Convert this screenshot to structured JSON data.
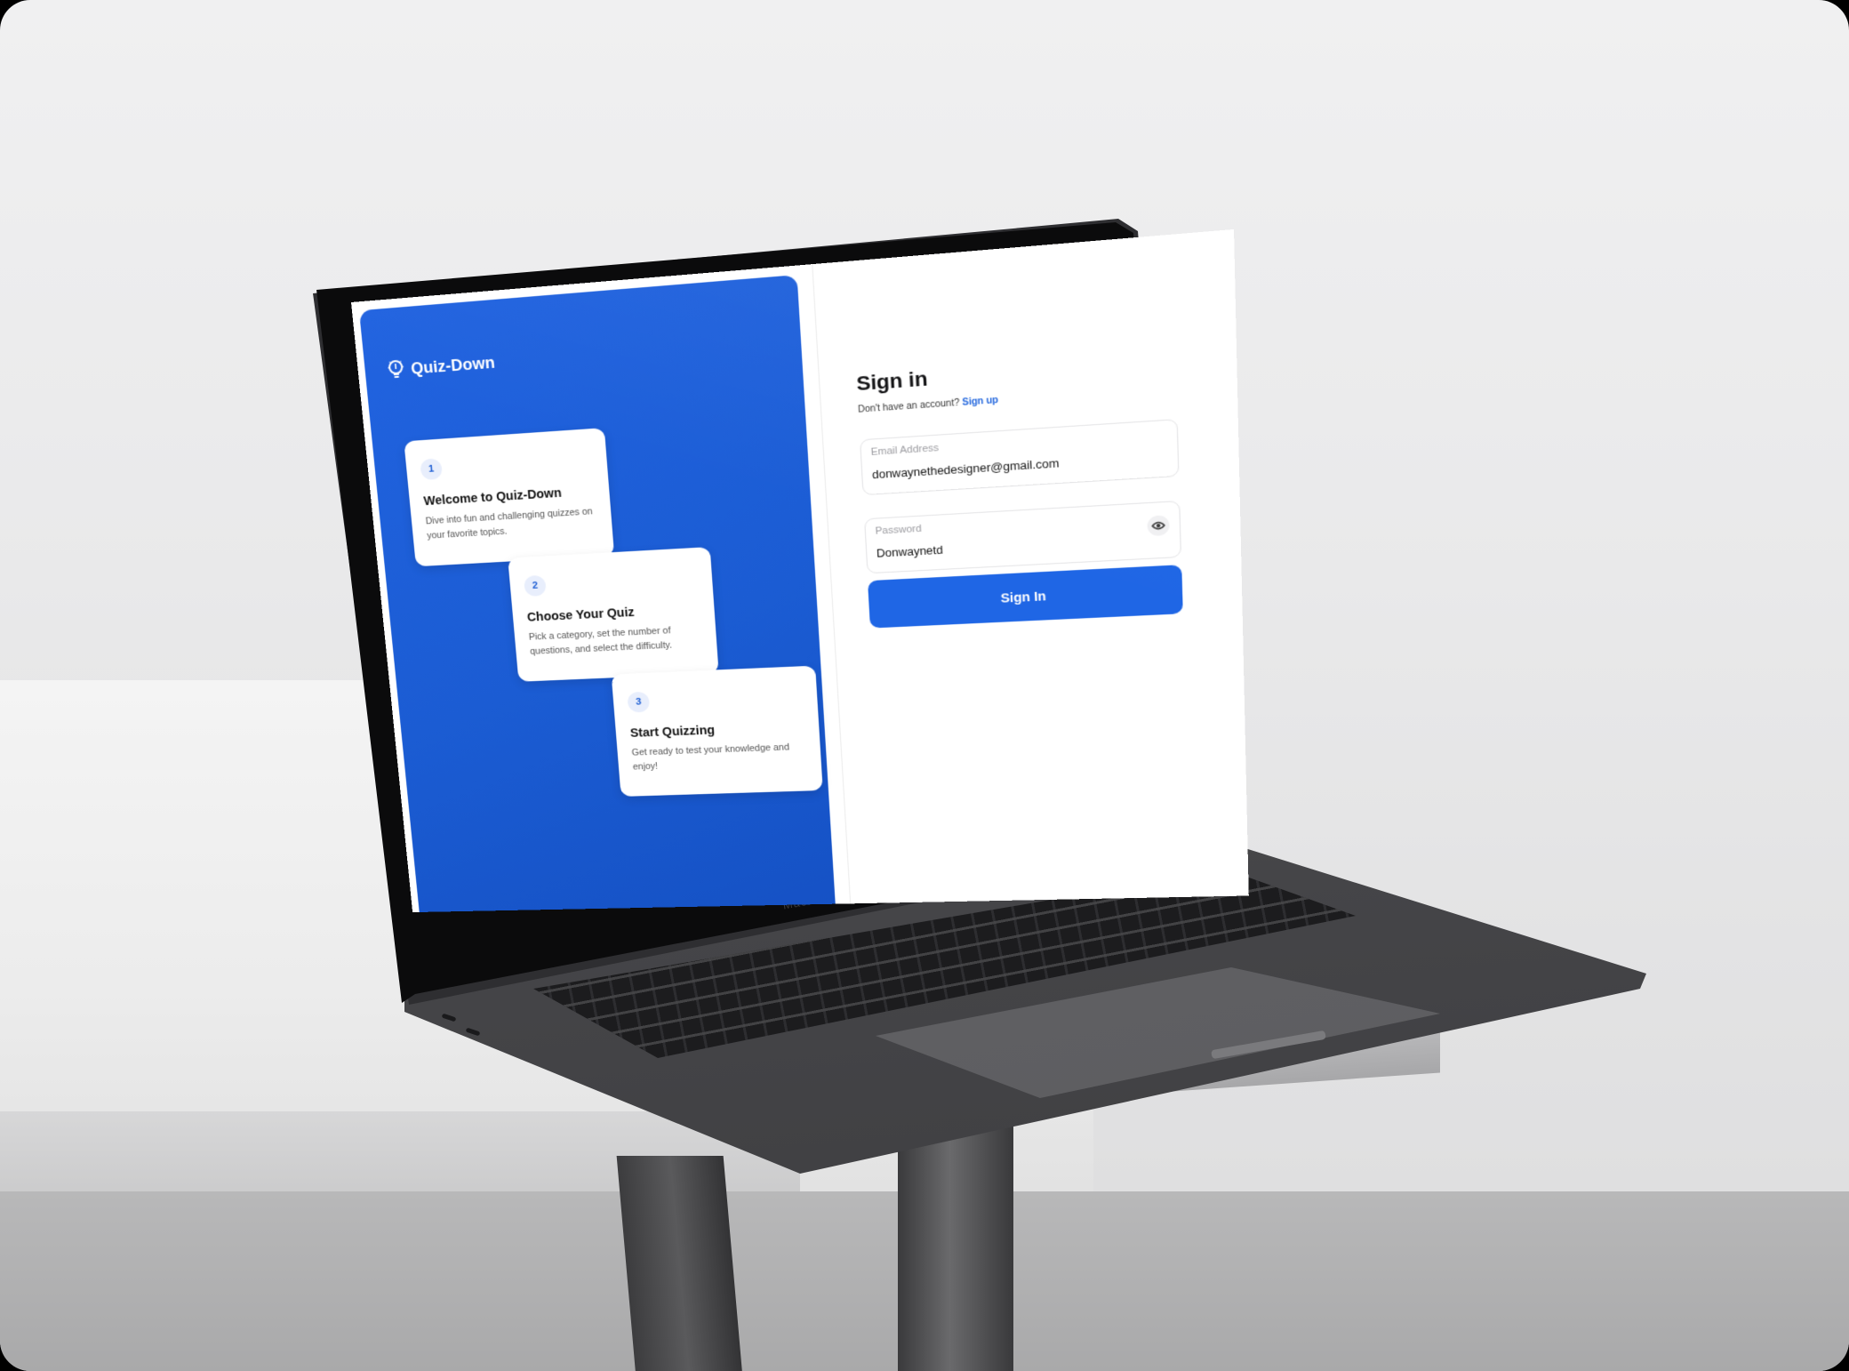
{
  "device": {
    "label": "MacBook Pro"
  },
  "brand": {
    "name": "Quiz-Down",
    "icon": "lightbulb-icon"
  },
  "steps": [
    {
      "number": "1",
      "title": "Welcome to Quiz-Down",
      "description": "Dive into fun and challenging quizzes on your favorite topics."
    },
    {
      "number": "2",
      "title": "Choose Your Quiz",
      "description": "Pick a category, set the number of questions, and select the difficulty."
    },
    {
      "number": "3",
      "title": "Start Quizzing",
      "description": "Get ready to test your knowledge and enjoy!"
    }
  ],
  "signin": {
    "title": "Sign in",
    "prompt": "Don't have an account?",
    "signup_link": "Sign up",
    "email": {
      "label": "Email Address",
      "value": "donwaynethedesigner@gmail.com"
    },
    "password": {
      "label": "Password",
      "value": "Donwaynetd",
      "toggle_icon": "eye-icon"
    },
    "button_label": "Sign In"
  },
  "colors": {
    "brand_blue": "#1b5cd3",
    "button_blue": "#1f66e5",
    "link_blue": "#1d63dd"
  }
}
